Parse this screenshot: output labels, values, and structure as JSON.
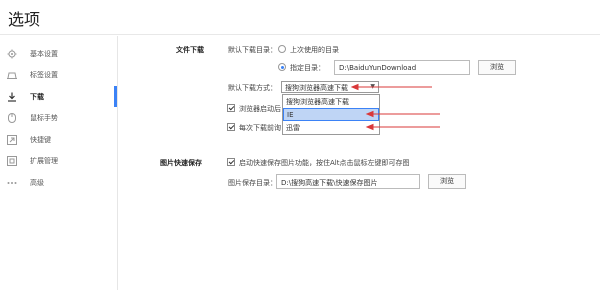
{
  "window": {
    "title": "选项"
  },
  "sidebar": {
    "items": [
      {
        "label": "基本设置",
        "icon": "gear-icon",
        "active": false
      },
      {
        "label": "标签设置",
        "icon": "tab-icon",
        "active": false
      },
      {
        "label": "下载",
        "icon": "download-icon",
        "active": true
      },
      {
        "label": "鼠标手势",
        "icon": "mouse-icon",
        "active": false
      },
      {
        "label": "快捷键",
        "icon": "shortcut-icon",
        "active": false
      },
      {
        "label": "扩展管理",
        "icon": "extension-icon",
        "active": false
      },
      {
        "label": "高级",
        "icon": "more-icon",
        "active": false
      }
    ]
  },
  "download": {
    "section_label": "文件下载",
    "default_dir_label": "默认下载目录：",
    "last_used_label": "上次使用的目录",
    "specified_label": "指定目录：",
    "path_value": "D:\\BaiduYunDownload",
    "browse_label": "浏览",
    "method_label": "默认下载方式：",
    "method_selected": "搜狗浏览器高速下载",
    "method_options": [
      {
        "label": "搜狗浏览器高速下载",
        "selected": false
      },
      {
        "label": "IE",
        "selected": true
      },
      {
        "label": "迅雷",
        "selected": false
      }
    ],
    "check1_label": "浏览器启动后",
    "check2_label": "每次下载前询"
  },
  "image_save": {
    "section_label": "图片快速保存",
    "enable_label": "启动快速保存图片功能，按住Alt点击鼠标左键即可存图",
    "dir_label": "图片保存目录：",
    "dir_value": "D:\\搜狗高速下载\\快速保存图片",
    "browse_label": "浏览"
  },
  "colors": {
    "accent": "#3b82f6",
    "annotation_arrow": "#d9383a"
  }
}
